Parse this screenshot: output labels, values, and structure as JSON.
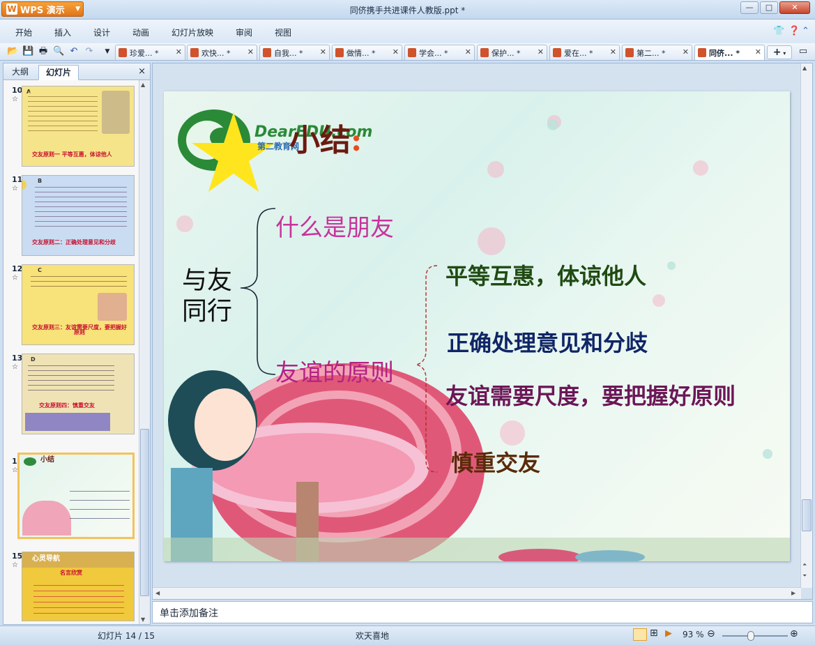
{
  "app": {
    "name": "WPS 演示",
    "window_title": "同侪携手共进课件人教版.ppt *",
    "controls": {
      "minimize": "—",
      "maximize": "□",
      "close": "✕"
    }
  },
  "menu": {
    "items": [
      "开始",
      "插入",
      "设计",
      "动画",
      "幻灯片放映",
      "审阅",
      "视图"
    ]
  },
  "doc_tabs": [
    {
      "label": "珍爱... *",
      "active": false
    },
    {
      "label": "欢快... *",
      "active": false
    },
    {
      "label": "自我... *",
      "active": false
    },
    {
      "label": "做情... *",
      "active": false
    },
    {
      "label": "学会... *",
      "active": false
    },
    {
      "label": "保护... *",
      "active": false
    },
    {
      "label": "爱在... *",
      "active": false
    },
    {
      "label": "第二... *",
      "active": false
    },
    {
      "label": "同侪... *",
      "active": true
    }
  ],
  "left_pane": {
    "tabs": [
      "大纲",
      "幻灯片"
    ],
    "active_tab": "幻灯片",
    "close": "×",
    "thumbnails": [
      {
        "num": "10",
        "star": "☆",
        "caption": "交友原则一  平等互惠，体谅他人",
        "label": "A",
        "bg": "#f6e48a"
      },
      {
        "num": "11",
        "star": "☆",
        "caption": "交友原则二：正确处理意见和分歧",
        "label": "B",
        "bg": "#c9dcf2"
      },
      {
        "num": "12",
        "star": "☆",
        "caption": "交友原则三：友谊需要尺度，要把握好原则",
        "label": "C",
        "bg": "#f8e27a"
      },
      {
        "num": "13",
        "star": "☆",
        "caption": "交友原则四：慎重交友",
        "label": "D",
        "bg": "#efe3b6"
      },
      {
        "num": "14",
        "star": "☆",
        "caption": "小结",
        "label": "",
        "bg": "#e3f4ec",
        "selected": true
      },
      {
        "num": "15",
        "star": "☆",
        "caption": "名言欣赏",
        "label": "心灵导航",
        "bg": "#f1c93d"
      }
    ]
  },
  "slide": {
    "title": "小结",
    "colon": ":",
    "logo_text": "DearEDU.com",
    "logo_sub": "第二教育网",
    "left_topic": "与友\n同行",
    "branch1": "什么是朋友",
    "branch2": "友谊的原则",
    "principles": [
      "平等互惠，体谅他人",
      "正确处理意见和分歧",
      "友谊需要尺度，要把握好原则",
      "慎重交友"
    ]
  },
  "notes_placeholder": "单击添加备注",
  "status": {
    "slide_info": "幻灯片 14 / 15",
    "theme": "欢天喜地",
    "zoom": "93 %"
  },
  "colors": {
    "branch1": "#c8339b",
    "branch2": "#b42384",
    "principle1": "#1f4a12",
    "principle2": "#0f2566",
    "principle3": "#6b1757",
    "principle4": "#5a2a08",
    "title": "#6b1a10"
  }
}
